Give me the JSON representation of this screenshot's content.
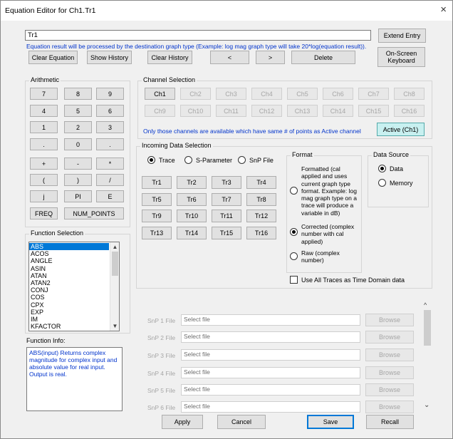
{
  "window": {
    "title": "Equation Editor for Ch1.Tr1",
    "close_icon": "×"
  },
  "equation": {
    "value": "Tr1",
    "note": "Equation result will be processed by the destination graph type (Example: log mag graph type will take 20*log(equation result)).",
    "extend_entry": "Extend Entry",
    "clear_equation": "Clear Equation",
    "show_history": "Show History",
    "clear_history": "Clear History",
    "prev": "<",
    "next": ">",
    "delete": "Delete",
    "onscreen_keyboard": "On-Screen Keyboard"
  },
  "arithmetic": {
    "label": "Arithmetic",
    "keys": [
      "7",
      "8",
      "9",
      "4",
      "5",
      "6",
      "1",
      "2",
      "3",
      ".",
      "0",
      "."
    ],
    "ops": [
      "+",
      "-",
      "*",
      "(",
      ")",
      "/",
      "j",
      "PI",
      "E"
    ],
    "freq": "FREQ",
    "num_points": "NUM_POINTS"
  },
  "channel_selection": {
    "label": "Channel Selection",
    "channels": [
      "Ch1",
      "Ch2",
      "Ch3",
      "Ch4",
      "Ch5",
      "Ch6",
      "Ch7",
      "Ch8",
      "Ch9",
      "Ch10",
      "Ch11",
      "Ch12",
      "Ch13",
      "Ch14",
      "Ch15",
      "Ch16"
    ],
    "note": "Only those channels are available which have same # of points as Active channel",
    "active_button": "Active (Ch1)"
  },
  "incoming": {
    "label": "Incoming Data Selection",
    "radio_trace": "Trace",
    "radio_sparam": "S-Parameter",
    "radio_snp": "SnP File",
    "traces": [
      "Tr1",
      "Tr2",
      "Tr3",
      "Tr4",
      "Tr5",
      "Tr6",
      "Tr7",
      "Tr8",
      "Tr9",
      "Tr10",
      "Tr11",
      "Tr12",
      "Tr13",
      "Tr14",
      "Tr15",
      "Tr16"
    ],
    "format_label": "Format",
    "formatted": "Formatted (cal applied and uses current graph type format. Example: log mag graph type on a trace will produce a variable in dB)",
    "corrected": "Corrected (complex number with cal applied)",
    "raw": "Raw (complex number)",
    "data_source_label": "Data Source",
    "ds_data": "Data",
    "ds_memory": "Memory",
    "use_all_traces": "Use All Traces as Time Domain data"
  },
  "functions": {
    "label": "Function Selection",
    "items": [
      "ABS",
      "ACOS",
      "ANGLE",
      "ASIN",
      "ATAN",
      "ATAN2",
      "CONJ",
      "COS",
      "CPX",
      "EXP",
      "IM",
      "KFACTOR"
    ],
    "info_label": "Function Info:",
    "info_text": "ABS(input) Returns complex magnitude for complex input and absolute value for real input.  Output is real."
  },
  "snp": {
    "rows": [
      {
        "label": "SnP 1 File",
        "placeholder": "Select file",
        "browse": "Browse"
      },
      {
        "label": "SnP 2 File",
        "placeholder": "Select file",
        "browse": "Browse"
      },
      {
        "label": "SnP 3 File",
        "placeholder": "Select file",
        "browse": "Browse"
      },
      {
        "label": "SnP 4 File",
        "placeholder": "Select file",
        "browse": "Browse"
      },
      {
        "label": "SnP 5 File",
        "placeholder": "Select file",
        "browse": "Browse"
      },
      {
        "label": "SnP 6 File",
        "placeholder": "Select file",
        "browse": "Browse"
      }
    ]
  },
  "footer": {
    "apply": "Apply",
    "cancel": "Cancel",
    "save": "Save",
    "recall": "Recall"
  },
  "colors": {
    "accent": "#0078d7",
    "note_blue": "#0033cc",
    "active_channel_bg": "#c8f0f0"
  }
}
